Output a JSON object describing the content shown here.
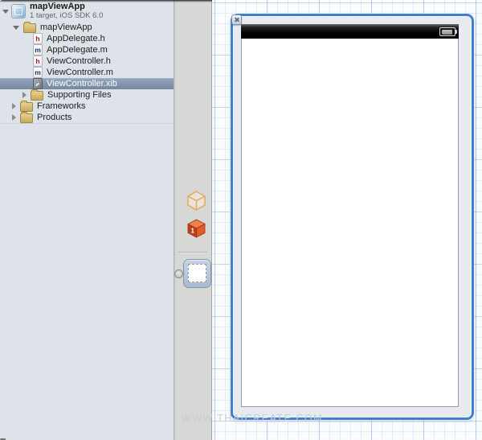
{
  "window": {
    "watermark": "WWW.THAICREATE.COM"
  },
  "navigator": {
    "project": {
      "name": "mapViewApp",
      "subtitle": "1 target, iOS SDK 6.0"
    },
    "items": [
      {
        "label": "mapViewApp"
      },
      {
        "label": "AppDelegate.h",
        "badge": "h"
      },
      {
        "label": "AppDelegate.m",
        "badge": "m"
      },
      {
        "label": "ViewController.h",
        "badge": "h"
      },
      {
        "label": "ViewController.m",
        "badge": "m"
      },
      {
        "label": "ViewController.xib"
      },
      {
        "label": "Supporting Files"
      },
      {
        "label": "Frameworks"
      },
      {
        "label": "Products"
      }
    ],
    "selected_item": "ViewController.xib"
  },
  "dock": {
    "items": [
      {
        "name": "files-owner"
      },
      {
        "name": "first-responder",
        "badge": "1"
      },
      {
        "name": "view"
      }
    ]
  },
  "colors": {
    "sidebar_bg": "#dee3e9",
    "selection_highlight": "#8093ab",
    "dock_bg": "#d7d7d5",
    "canvas_grid": "#aec4e8",
    "container_border": "#3d80d2",
    "status_bar": "#000000",
    "folder": "#d4b268",
    "responder_cube": "#e2592a",
    "owner_cube_outline": "#dfa95f"
  }
}
